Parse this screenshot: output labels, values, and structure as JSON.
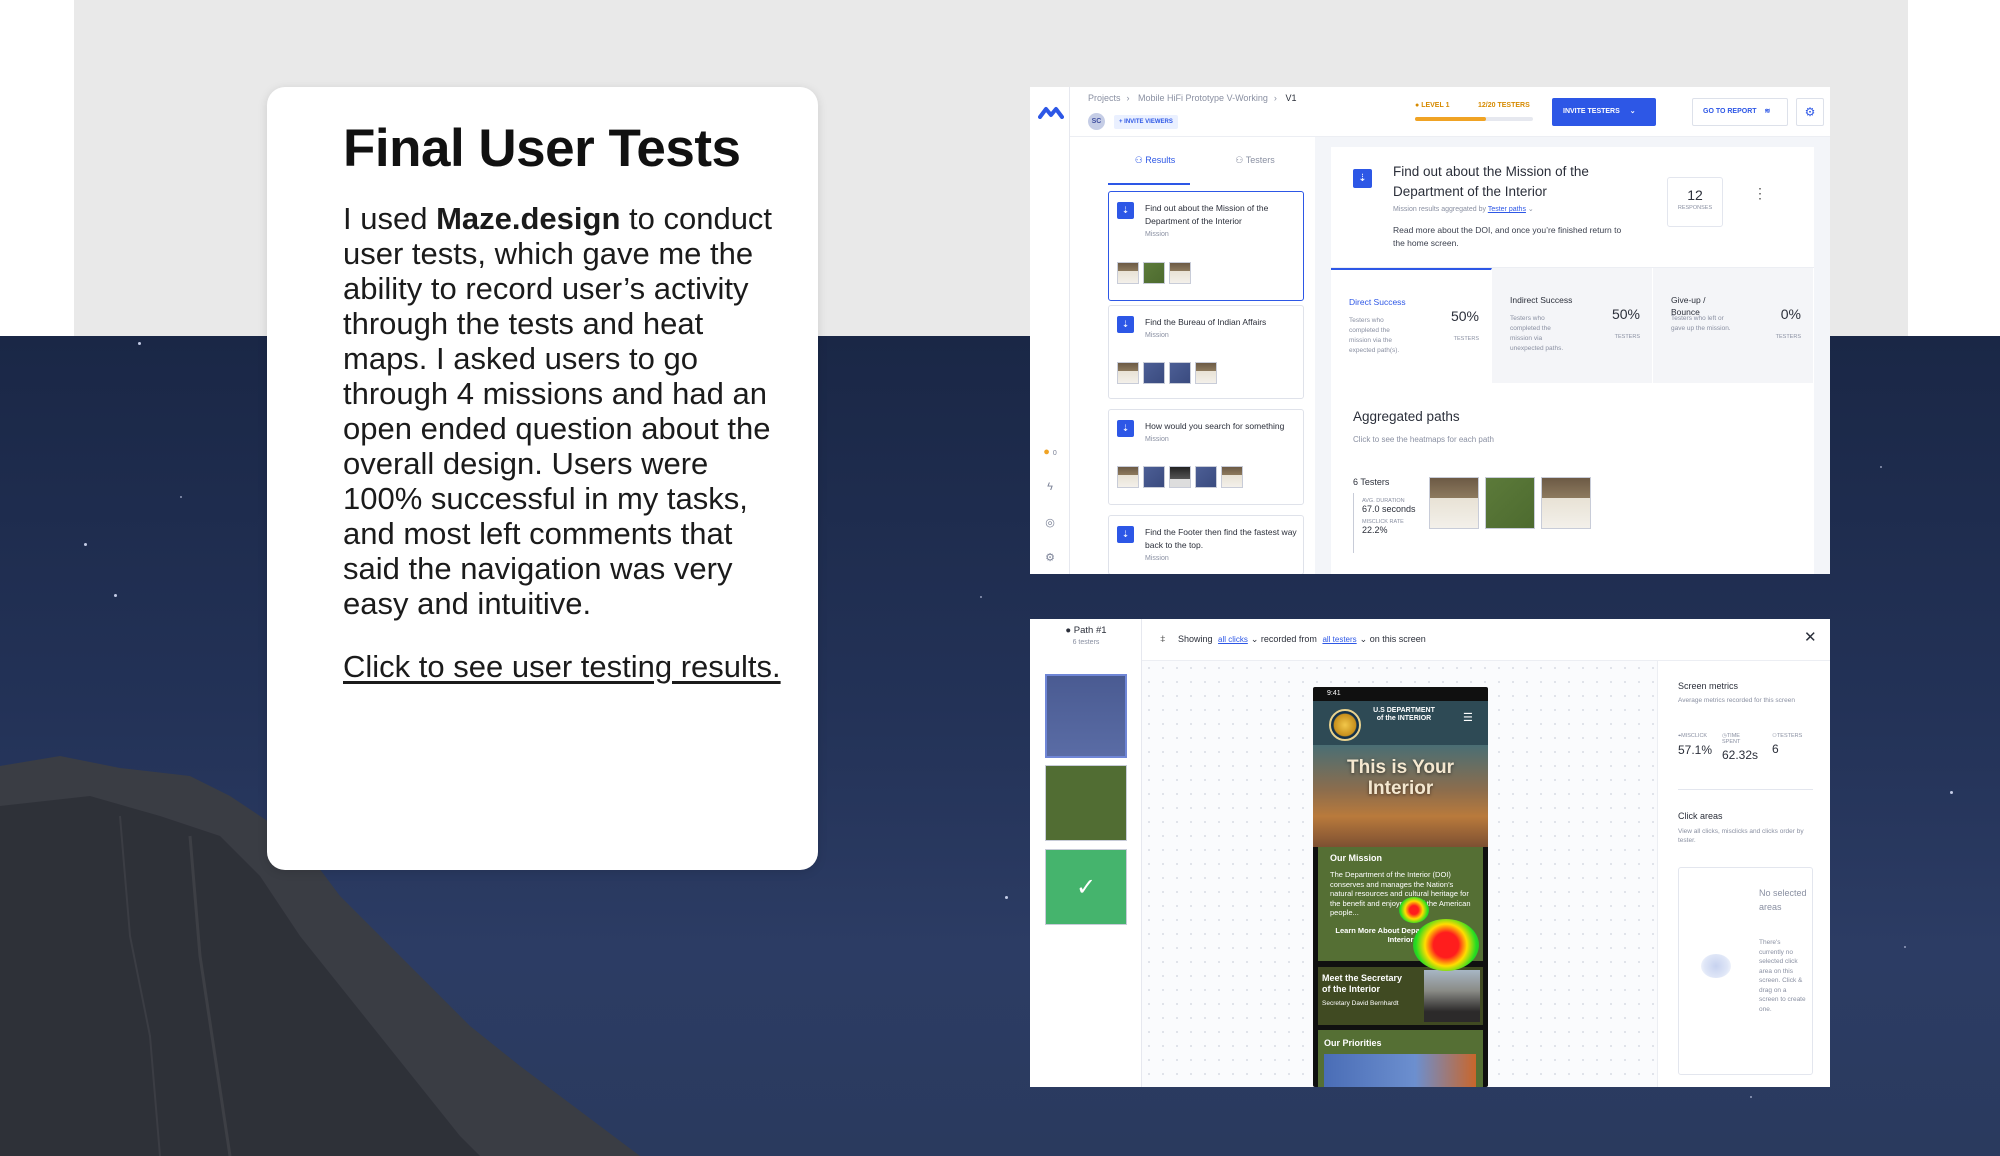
{
  "card": {
    "title": "Final User Tests",
    "body_prefix": "I used ",
    "body_bold": "Maze.design",
    "body_suffix": " to conduct user tests, which gave me the ability to record user’s activity through the tests and heat maps. I asked users to go through 4 missions and had an open ended question about the overall design. Users were 100% successful in my tasks, and most left comments that said the navigation was very easy and intuitive.",
    "link": "Click to see user testing results."
  },
  "results_screen": {
    "breadcrumb": [
      "Projects",
      "Mobile HiFi Prototype V-Working",
      "V1"
    ],
    "avatar": "SC",
    "invite_viewers": "+ INVITE VIEWERS",
    "level": "LEVEL 1",
    "testers_count": "12/20 TESTERS",
    "level_progress": 0.6,
    "invite_testers": "INVITE TESTERS",
    "go_to_report": "GO TO REPORT",
    "rail_count": "0",
    "tabs": {
      "results": "Results",
      "testers": "Testers"
    },
    "missions": [
      {
        "title": "Find out about the Mission of the Department of the Interior",
        "type": "Mission"
      },
      {
        "title": "Find the Bureau of Indian Affairs",
        "type": "Mission"
      },
      {
        "title": "How would you search for something",
        "type": "Mission"
      },
      {
        "title": "Find the Footer then find the fastest way back to the top.",
        "type": "Mission"
      }
    ],
    "panel": {
      "title": "Find out about the Mission of the Department of the Interior",
      "sub_prefix": "Mission results aggregated by ",
      "sub_link": "Tester paths",
      "description": "Read more about the DOI, and once you’re finished return to the home screen.",
      "responses": "12",
      "responses_label": "RESPONSES"
    },
    "stats": [
      {
        "name": "Direct Success",
        "desc": "Testers who completed the mission via the expected path(s).",
        "value": "50%",
        "unit": "TESTERS"
      },
      {
        "name": "Indirect Success",
        "desc": "Testers who completed the mission via unexpected paths.",
        "value": "50%",
        "unit": "TESTERS"
      },
      {
        "name": "Give-up / Bounce",
        "desc": "Testers who left or gave up the mission.",
        "value": "0%",
        "unit": "TESTERS"
      }
    ],
    "aggregated": {
      "title": "Aggregated paths",
      "subtitle": "Click to see the heatmaps for each path",
      "testers": "6 Testers",
      "avg_label": "AVG. DURATION",
      "avg_value": "67.0 seconds",
      "misclick_label": "MISCLICK RATE",
      "misclick_value": "22.2%"
    }
  },
  "heatmap_screen": {
    "path_label": "● Path #1",
    "path_sub": "6 testers",
    "showing": "Showing",
    "all_clicks": "all clicks",
    "recorded_from": "recorded from",
    "all_testers": "all testers",
    "on_screen": "on this screen",
    "phone": {
      "time": "9:41",
      "dept": "U.S DEPARTMENT of the INTERIOR",
      "hero": "This is Your Interior",
      "mission_title": "Our Mission",
      "mission_text": "The Department of the Interior (DOI) conserves and manages the Nation’s natural resources and cultural heritage for the benefit and enjoyment of the American people...",
      "learn_more": "Learn More About Department of the Interior",
      "secretary_title": "Meet the Secretary of the Interior",
      "secretary_name": "Secretary David Bernhardt",
      "priorities": "Our Priorities"
    },
    "metrics": {
      "title": "Screen metrics",
      "subtitle": "Average metrics recorded for this screen",
      "misclick_label": "MISCLICK",
      "misclick": "57.1%",
      "time_label": "TIME SPENT",
      "time": "62.32s",
      "testers_label": "TESTERS",
      "testers": "6"
    },
    "click_areas": {
      "title": "Click areas",
      "subtitle": "View all clicks, misclicks and clicks order by tester.",
      "none": "No selected areas",
      "text": "There's currently no selected click area on this screen. Click & drag on a screen to create one."
    }
  }
}
